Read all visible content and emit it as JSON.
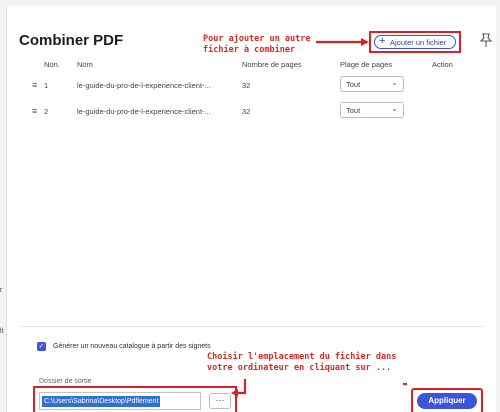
{
  "dialog": {
    "title": "Combiner PDF",
    "add_button_label": "Ajouter un fichier",
    "pin_icon": "pin-icon"
  },
  "table": {
    "headers": [
      "Non.",
      "Nom",
      "Nombre de pages",
      "Plage de pages",
      "Action"
    ],
    "rows": [
      {
        "num": "1",
        "name": "le-guide-du-pro-de-l-experience-client-...",
        "pages": "32",
        "range": "Tout"
      },
      {
        "num": "2",
        "name": "le-guide-du-pro-de-l-experience-client-...",
        "pages": "32",
        "range": "Tout"
      }
    ]
  },
  "annotations": {
    "add_note_line1": "Pour ajouter un autre",
    "add_note_line2": "fichier à combiner",
    "path_note_line1": "Choisir l'emplacement du fichier dans",
    "path_note_line2": "votre ordinateur en cliquant sur ..."
  },
  "options": {
    "catalog_checkbox_label": "Générer un nouveau catalogue à partir des signets",
    "catalog_checked": true
  },
  "output": {
    "label": "Dossier de sortie",
    "path": "C:\\Users\\Sabrina\\Desktop\\Pdflement",
    "browse_label": "···"
  },
  "footer": {
    "apply_label": "Appliquer"
  },
  "colors": {
    "accent": "#3d55d8",
    "annotation": "#d92027"
  },
  "stray": [
    "r",
    "lt"
  ]
}
